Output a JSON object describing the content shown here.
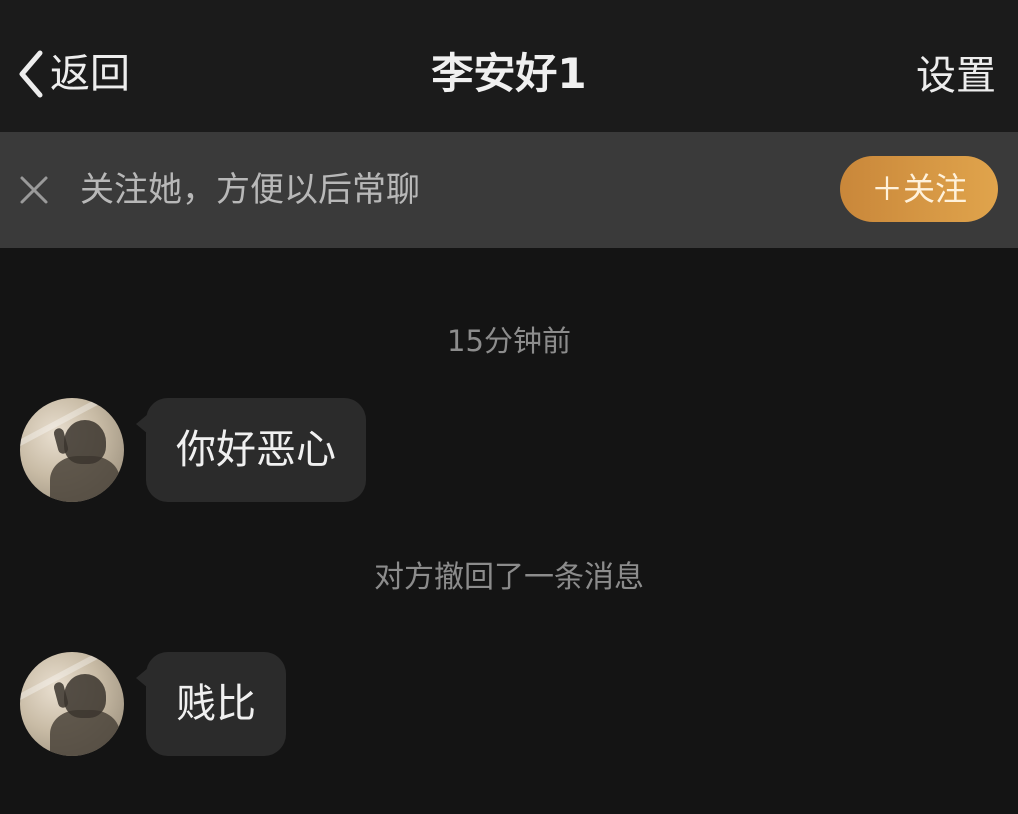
{
  "header": {
    "back_label": "返回",
    "title": "李安好1",
    "settings_label": "设置"
  },
  "banner": {
    "text": "关注她，方便以后常聊",
    "follow_button": "＋关注",
    "accent_color": "#d8963f"
  },
  "chat": {
    "timestamp": "15分钟前",
    "messages": [
      {
        "text": "你好恶心"
      },
      {
        "text": "贱比"
      }
    ],
    "system_message": "对方撤回了一条消息"
  },
  "icons": {
    "back": "chevron-left-icon",
    "close": "close-icon"
  }
}
